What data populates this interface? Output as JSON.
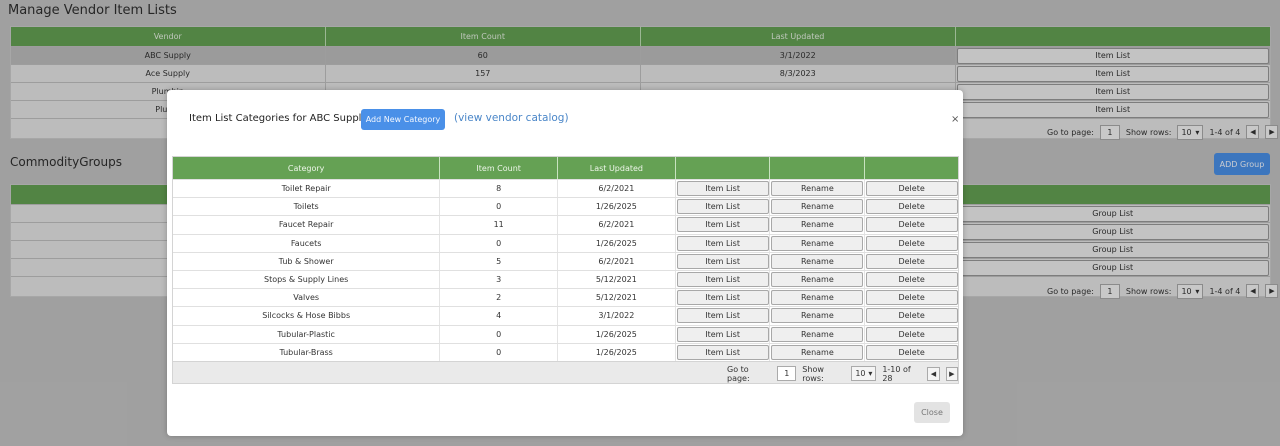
{
  "page": {
    "title": "Manage Vendor Item Lists",
    "section2_title": "CommodityGroups",
    "add_group_label": "ADD Group"
  },
  "vendor_table": {
    "headers": [
      "Vendor",
      "Item Count",
      "Last Updated",
      ""
    ],
    "rows": [
      {
        "vendor": "ABC Supply",
        "count": "60",
        "updated": "3/1/2022",
        "action": "Item List"
      },
      {
        "vendor": "Ace Supply",
        "count": "157",
        "updated": "8/3/2023",
        "action": "Item List"
      },
      {
        "vendor": "Plumbin",
        "count": "",
        "updated": "",
        "action": "Item List"
      },
      {
        "vendor": "Plumb",
        "count": "",
        "updated": "",
        "action": "Item List"
      }
    ],
    "pager": {
      "go_to": "Go to page:",
      "page": "1",
      "show_rows": "Show rows:",
      "rows": "10",
      "range": "1-4 of 4"
    }
  },
  "group_table": {
    "rows": [
      {
        "action": "Group List"
      },
      {
        "action": "Group List"
      },
      {
        "action": "Group List"
      },
      {
        "action": "Group List"
      }
    ],
    "pager": {
      "go_to": "Go to page:",
      "page": "1",
      "show_rows": "Show rows:",
      "rows": "10",
      "range": "1-4 of 4"
    }
  },
  "modal": {
    "title": "Item List Categories for ABC Supply",
    "add_category": "Add New Category",
    "view_catalog": "(view vendor catalog)",
    "close_x": "×",
    "headers": [
      "Category",
      "Item Count",
      "Last Updated",
      "",
      "",
      ""
    ],
    "rows": [
      {
        "category": "Toilet Repair",
        "count": "8",
        "updated": "6/2/2021"
      },
      {
        "category": "Toilets",
        "count": "0",
        "updated": "1/26/2025"
      },
      {
        "category": "Faucet Repair",
        "count": "11",
        "updated": "6/2/2021"
      },
      {
        "category": "Faucets",
        "count": "0",
        "updated": "1/26/2025"
      },
      {
        "category": "Tub & Shower",
        "count": "5",
        "updated": "6/2/2021"
      },
      {
        "category": "Stops & Supply Lines",
        "count": "3",
        "updated": "5/12/2021"
      },
      {
        "category": "Valves",
        "count": "2",
        "updated": "5/12/2021"
      },
      {
        "category": "Silcocks & Hose Bibbs",
        "count": "4",
        "updated": "3/1/2022"
      },
      {
        "category": "Tubular-Plastic",
        "count": "0",
        "updated": "1/26/2025"
      },
      {
        "category": "Tubular-Brass",
        "count": "0",
        "updated": "1/26/2025"
      }
    ],
    "row_buttons": {
      "item_list": "Item List",
      "rename": "Rename",
      "delete": "Delete"
    },
    "pager": {
      "go_to": "Go to page:",
      "page": "1",
      "show_rows": "Show rows:",
      "rows": "10",
      "range": "1-10 of 28"
    },
    "close_label": "Close"
  },
  "icons": {
    "prev": "chevron-left-icon",
    "next": "chevron-right-icon",
    "dropdown": "chevron-down-icon"
  },
  "colors": {
    "header_green": "#65a154",
    "accent_blue": "#4a90e8",
    "link_blue": "#4a86c8"
  }
}
